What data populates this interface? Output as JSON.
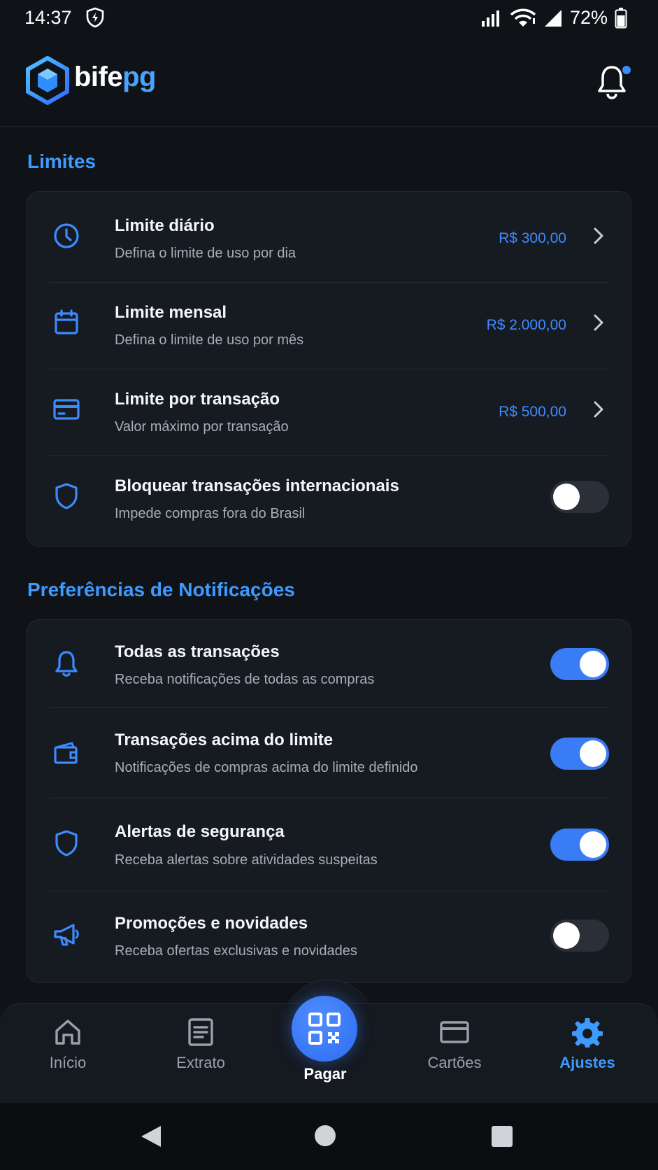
{
  "status_bar": {
    "time": "14:37",
    "battery": "72%"
  },
  "header": {
    "logo_primary": "bife",
    "logo_accent": "pg",
    "has_notification": true
  },
  "limits": {
    "title": "Limites",
    "items": [
      {
        "title": "Limite diário",
        "subtitle": "Defina o limite de uso por dia",
        "value": "R$ 300,00",
        "icon": "clock-icon"
      },
      {
        "title": "Limite mensal",
        "subtitle": "Defina o limite de uso por mês",
        "value": "R$ 2.000,00",
        "icon": "calendar-icon"
      },
      {
        "title": "Limite por transação",
        "subtitle": "Valor máximo por transação",
        "value": "R$ 500,00",
        "icon": "credit-card-icon"
      },
      {
        "title": "Bloquear transações internacionais",
        "subtitle": "Impede compras fora do Brasil",
        "icon": "shield-icon",
        "toggle": false
      }
    ]
  },
  "notifications": {
    "title": "Preferências de Notificações",
    "items": [
      {
        "title": "Todas as transações",
        "subtitle": "Receba notificações de todas as compras",
        "icon": "bell-icon",
        "toggle": true
      },
      {
        "title": "Transações acima do limite",
        "subtitle": "Notificações de compras acima do limite definido",
        "icon": "wallet-icon",
        "toggle": true
      },
      {
        "title": "Alertas de segurança",
        "subtitle": "Receba alertas sobre atividades suspeitas",
        "icon": "shield-icon",
        "toggle": true
      },
      {
        "title": "Promoções e novidades",
        "subtitle": "Receba ofertas exclusivas e novidades",
        "icon": "megaphone-icon",
        "toggle": false
      }
    ]
  },
  "bottom_nav": {
    "items": [
      {
        "label": "Início",
        "icon": "home-icon",
        "active": false
      },
      {
        "label": "Extrato",
        "icon": "document-icon",
        "active": false
      },
      {
        "label": "Pagar",
        "icon": "qr-code-icon",
        "active": false
      },
      {
        "label": "Cartões",
        "icon": "credit-card-icon",
        "active": false
      },
      {
        "label": "Ajustes",
        "icon": "gear-icon",
        "active": true
      }
    ]
  },
  "colors": {
    "accent": "#3d9bff",
    "toggle_on": "#3a7cf5",
    "background": "#0f1217",
    "card": "#161a21"
  }
}
